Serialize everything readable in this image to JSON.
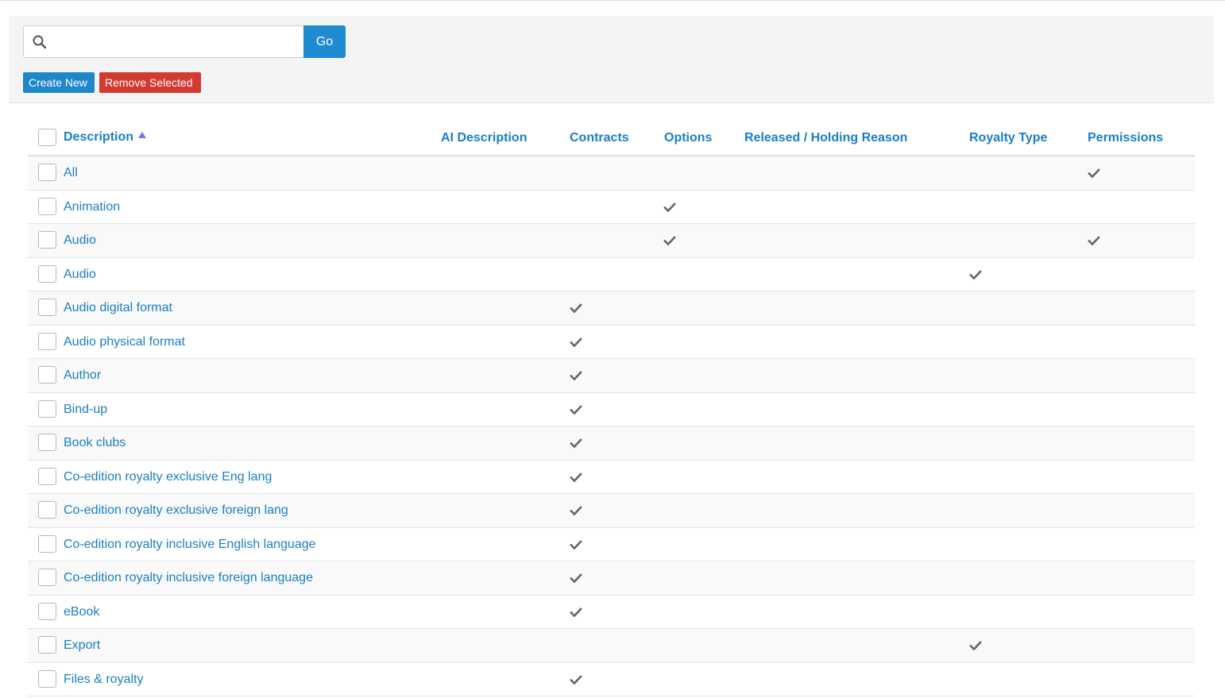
{
  "search": {
    "placeholder": "",
    "value": "",
    "go_label": "Go"
  },
  "actions": {
    "create_new": "Create New",
    "remove_selected": "Remove Selected"
  },
  "colors": {
    "link": "#1a7fc4",
    "primary": "#1f8bd0",
    "danger": "#d33a30"
  },
  "columns": {
    "description": "Description",
    "ai_description": "AI Description",
    "contracts": "Contracts",
    "options": "Options",
    "released": "Released / Holding Reason",
    "royalty_type": "Royalty Type",
    "permissions": "Permissions"
  },
  "sort": {
    "column": "description",
    "direction": "ascending",
    "icon": "sort-ascending-icon"
  },
  "rows": [
    {
      "description": "All",
      "contracts": false,
      "options": false,
      "royalty_type": false,
      "permissions": true
    },
    {
      "description": "Animation",
      "contracts": false,
      "options": true,
      "royalty_type": false,
      "permissions": false
    },
    {
      "description": "Audio",
      "contracts": false,
      "options": true,
      "royalty_type": false,
      "permissions": true
    },
    {
      "description": "Audio",
      "contracts": false,
      "options": false,
      "royalty_type": true,
      "permissions": false
    },
    {
      "description": "Audio digital format",
      "contracts": true,
      "options": false,
      "royalty_type": false,
      "permissions": false
    },
    {
      "description": "Audio physical format",
      "contracts": true,
      "options": false,
      "royalty_type": false,
      "permissions": false
    },
    {
      "description": "Author",
      "contracts": true,
      "options": false,
      "royalty_type": false,
      "permissions": false
    },
    {
      "description": "Bind-up",
      "contracts": true,
      "options": false,
      "royalty_type": false,
      "permissions": false
    },
    {
      "description": "Book clubs",
      "contracts": true,
      "options": false,
      "royalty_type": false,
      "permissions": false
    },
    {
      "description": "Co-edition royalty exclusive Eng lang",
      "contracts": true,
      "options": false,
      "royalty_type": false,
      "permissions": false
    },
    {
      "description": "Co-edition royalty exclusive foreign lang",
      "contracts": true,
      "options": false,
      "royalty_type": false,
      "permissions": false
    },
    {
      "description": "Co-edition royalty inclusive English language",
      "contracts": true,
      "options": false,
      "royalty_type": false,
      "permissions": false
    },
    {
      "description": "Co-edition royalty inclusive foreign language",
      "contracts": true,
      "options": false,
      "royalty_type": false,
      "permissions": false
    },
    {
      "description": "eBook",
      "contracts": true,
      "options": false,
      "royalty_type": false,
      "permissions": false
    },
    {
      "description": "Export",
      "contracts": false,
      "options": false,
      "royalty_type": true,
      "permissions": false
    },
    {
      "description": "Files & royalty",
      "contracts": true,
      "options": false,
      "royalty_type": false,
      "permissions": false
    }
  ]
}
